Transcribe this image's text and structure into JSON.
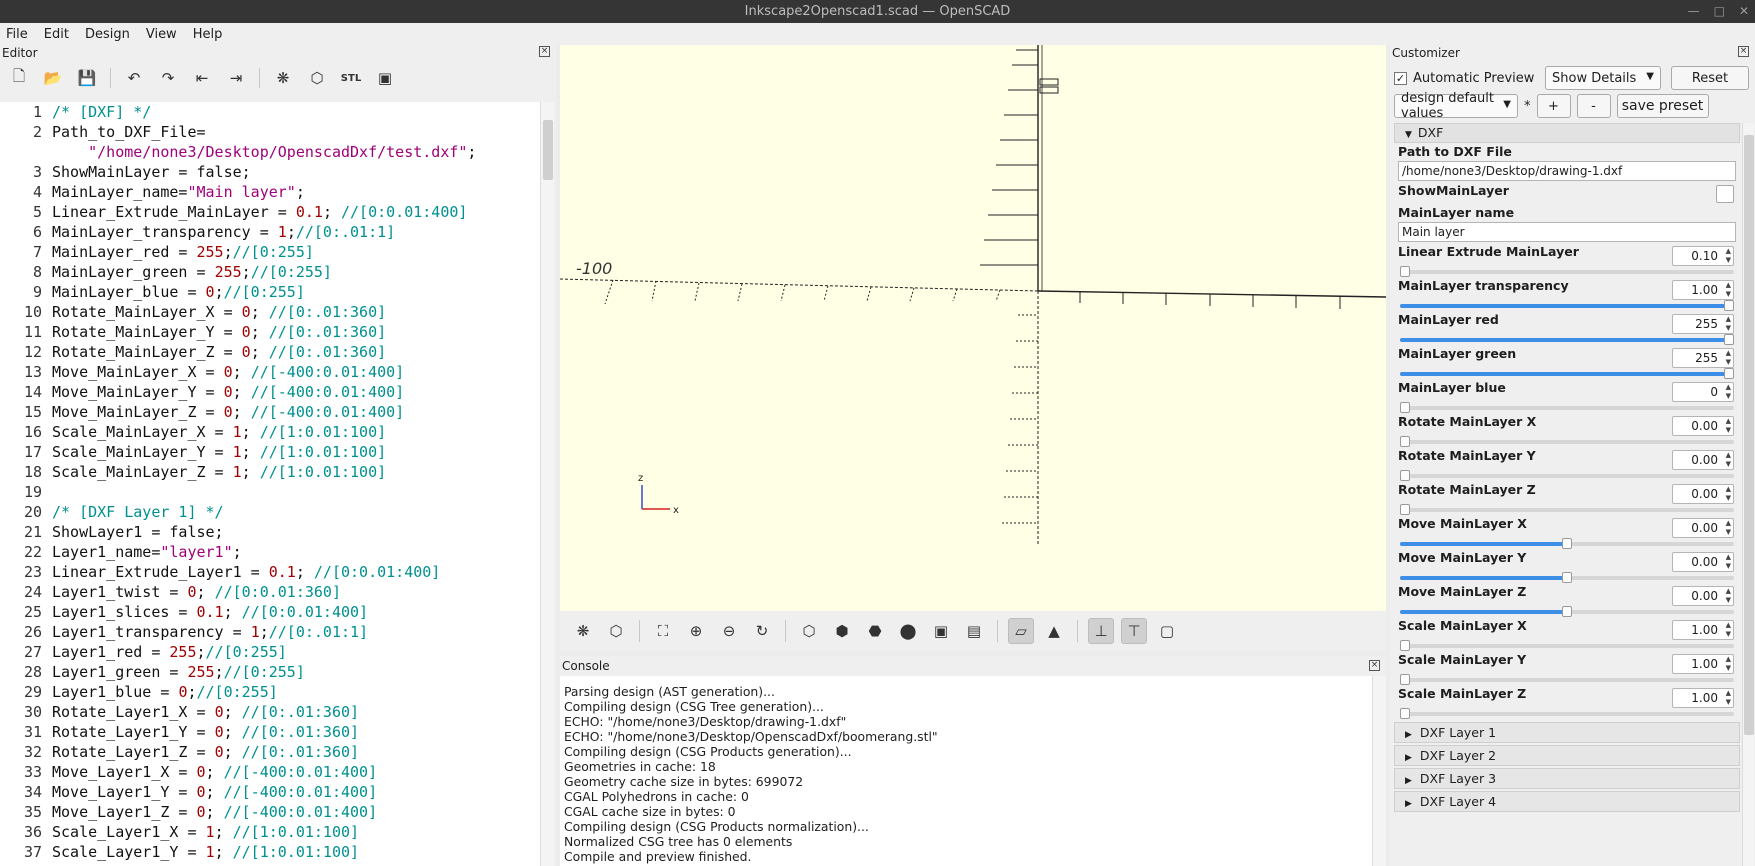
{
  "window": {
    "title": "Inkscape2Openscad1.scad — OpenSCAD"
  },
  "menu": [
    "File",
    "Edit",
    "Design",
    "View",
    "Help"
  ],
  "editor": {
    "title": "Editor",
    "lines": [
      {
        "n": "1",
        "t": [
          [
            "c-com",
            "/* [DXF] */"
          ]
        ]
      },
      {
        "n": "2",
        "t": [
          [
            "code",
            "Path_to_DXF_File="
          ]
        ]
      },
      {
        "n": "",
        "t": [
          [
            "code",
            "    "
          ],
          [
            "c-str",
            "\"/home/none3/Desktop/OpenscadDxf/test.dxf\""
          ],
          [
            "code",
            ";"
          ]
        ]
      },
      {
        "n": "3",
        "t": [
          [
            "code",
            "ShowMainLayer = false;"
          ]
        ]
      },
      {
        "n": "4",
        "t": [
          [
            "code",
            "MainLayer_name="
          ],
          [
            "c-str",
            "\"Main layer\""
          ],
          [
            "code",
            ";"
          ]
        ]
      },
      {
        "n": "5",
        "t": [
          [
            "code",
            "Linear_Extrude_MainLayer = "
          ],
          [
            "c-num",
            "0.1"
          ],
          [
            "code",
            "; "
          ],
          [
            "c-com",
            "//[0:0.01:400]"
          ]
        ]
      },
      {
        "n": "6",
        "t": [
          [
            "code",
            "MainLayer_transparency = "
          ],
          [
            "c-num",
            "1"
          ],
          [
            "code",
            ";"
          ],
          [
            "c-com",
            "//[0:.01:1]"
          ]
        ]
      },
      {
        "n": "7",
        "t": [
          [
            "code",
            "MainLayer_red = "
          ],
          [
            "c-num",
            "255"
          ],
          [
            "code",
            ";"
          ],
          [
            "c-com",
            "//[0:255]"
          ]
        ]
      },
      {
        "n": "8",
        "t": [
          [
            "code",
            "MainLayer_green = "
          ],
          [
            "c-num",
            "255"
          ],
          [
            "code",
            ";"
          ],
          [
            "c-com",
            "//[0:255]"
          ]
        ]
      },
      {
        "n": "9",
        "t": [
          [
            "code",
            "MainLayer_blue = "
          ],
          [
            "c-num",
            "0"
          ],
          [
            "code",
            ";"
          ],
          [
            "c-com",
            "//[0:255]"
          ]
        ]
      },
      {
        "n": "10",
        "t": [
          [
            "code",
            "Rotate_MainLayer_X = "
          ],
          [
            "c-num",
            "0"
          ],
          [
            "code",
            "; "
          ],
          [
            "c-com",
            "//[0:.01:360]"
          ]
        ]
      },
      {
        "n": "11",
        "t": [
          [
            "code",
            "Rotate_MainLayer_Y = "
          ],
          [
            "c-num",
            "0"
          ],
          [
            "code",
            "; "
          ],
          [
            "c-com",
            "//[0:.01:360]"
          ]
        ]
      },
      {
        "n": "12",
        "t": [
          [
            "code",
            "Rotate_MainLayer_Z = "
          ],
          [
            "c-num",
            "0"
          ],
          [
            "code",
            "; "
          ],
          [
            "c-com",
            "//[0:.01:360]"
          ]
        ]
      },
      {
        "n": "13",
        "t": [
          [
            "code",
            "Move_MainLayer_X = "
          ],
          [
            "c-num",
            "0"
          ],
          [
            "code",
            "; "
          ],
          [
            "c-com",
            "//[-400:0.01:400]"
          ]
        ]
      },
      {
        "n": "14",
        "t": [
          [
            "code",
            "Move_MainLayer_Y = "
          ],
          [
            "c-num",
            "0"
          ],
          [
            "code",
            "; "
          ],
          [
            "c-com",
            "//[-400:0.01:400]"
          ]
        ]
      },
      {
        "n": "15",
        "t": [
          [
            "code",
            "Move_MainLayer_Z = "
          ],
          [
            "c-num",
            "0"
          ],
          [
            "code",
            "; "
          ],
          [
            "c-com",
            "//[-400:0.01:400]"
          ]
        ]
      },
      {
        "n": "16",
        "t": [
          [
            "code",
            "Scale_MainLayer_X = "
          ],
          [
            "c-num",
            "1"
          ],
          [
            "code",
            "; "
          ],
          [
            "c-com",
            "//[1:0.01:100]"
          ]
        ]
      },
      {
        "n": "17",
        "t": [
          [
            "code",
            "Scale_MainLayer_Y = "
          ],
          [
            "c-num",
            "1"
          ],
          [
            "code",
            "; "
          ],
          [
            "c-com",
            "//[1:0.01:100]"
          ]
        ]
      },
      {
        "n": "18",
        "t": [
          [
            "code",
            "Scale_MainLayer_Z = "
          ],
          [
            "c-num",
            "1"
          ],
          [
            "code",
            "; "
          ],
          [
            "c-com",
            "//[1:0.01:100]"
          ]
        ]
      },
      {
        "n": "19",
        "t": [
          [
            "code",
            ""
          ]
        ]
      },
      {
        "n": "20",
        "t": [
          [
            "c-com",
            "/* [DXF Layer 1] */"
          ]
        ]
      },
      {
        "n": "21",
        "t": [
          [
            "code",
            "ShowLayer1 = false;"
          ]
        ]
      },
      {
        "n": "22",
        "t": [
          [
            "code",
            "Layer1_name="
          ],
          [
            "c-str",
            "\"layer1\""
          ],
          [
            "code",
            ";"
          ]
        ]
      },
      {
        "n": "23",
        "t": [
          [
            "code",
            "Linear_Extrude_Layer1 = "
          ],
          [
            "c-num",
            "0.1"
          ],
          [
            "code",
            "; "
          ],
          [
            "c-com",
            "//[0:0.01:400]"
          ]
        ]
      },
      {
        "n": "24",
        "t": [
          [
            "code",
            "Layer1_twist = "
          ],
          [
            "c-num",
            "0"
          ],
          [
            "code",
            "; "
          ],
          [
            "c-com",
            "//[0:0.01:360]"
          ]
        ]
      },
      {
        "n": "25",
        "t": [
          [
            "code",
            "Layer1_slices = "
          ],
          [
            "c-num",
            "0.1"
          ],
          [
            "code",
            "; "
          ],
          [
            "c-com",
            "//[0:0.01:400]"
          ]
        ]
      },
      {
        "n": "26",
        "t": [
          [
            "code",
            "Layer1_transparency = "
          ],
          [
            "c-num",
            "1"
          ],
          [
            "code",
            ";"
          ],
          [
            "c-com",
            "//[0:.01:1]"
          ]
        ]
      },
      {
        "n": "27",
        "t": [
          [
            "code",
            "Layer1_red = "
          ],
          [
            "c-num",
            "255"
          ],
          [
            "code",
            ";"
          ],
          [
            "c-com",
            "//[0:255]"
          ]
        ]
      },
      {
        "n": "28",
        "t": [
          [
            "code",
            "Layer1_green = "
          ],
          [
            "c-num",
            "255"
          ],
          [
            "code",
            ";"
          ],
          [
            "c-com",
            "//[0:255]"
          ]
        ]
      },
      {
        "n": "29",
        "t": [
          [
            "code",
            "Layer1_blue = "
          ],
          [
            "c-num",
            "0"
          ],
          [
            "code",
            ";"
          ],
          [
            "c-com",
            "//[0:255]"
          ]
        ]
      },
      {
        "n": "30",
        "t": [
          [
            "code",
            "Rotate_Layer1_X = "
          ],
          [
            "c-num",
            "0"
          ],
          [
            "code",
            "; "
          ],
          [
            "c-com",
            "//[0:.01:360]"
          ]
        ]
      },
      {
        "n": "31",
        "t": [
          [
            "code",
            "Rotate_Layer1_Y = "
          ],
          [
            "c-num",
            "0"
          ],
          [
            "code",
            "; "
          ],
          [
            "c-com",
            "//[0:.01:360]"
          ]
        ]
      },
      {
        "n": "32",
        "t": [
          [
            "code",
            "Rotate_Layer1_Z = "
          ],
          [
            "c-num",
            "0"
          ],
          [
            "code",
            "; "
          ],
          [
            "c-com",
            "//[0:.01:360]"
          ]
        ]
      },
      {
        "n": "33",
        "t": [
          [
            "code",
            "Move_Layer1_X = "
          ],
          [
            "c-num",
            "0"
          ],
          [
            "code",
            "; "
          ],
          [
            "c-com",
            "//[-400:0.01:400]"
          ]
        ]
      },
      {
        "n": "34",
        "t": [
          [
            "code",
            "Move_Layer1_Y = "
          ],
          [
            "c-num",
            "0"
          ],
          [
            "code",
            "; "
          ],
          [
            "c-com",
            "//[-400:0.01:400]"
          ]
        ]
      },
      {
        "n": "35",
        "t": [
          [
            "code",
            "Move_Layer1_Z = "
          ],
          [
            "c-num",
            "0"
          ],
          [
            "code",
            "; "
          ],
          [
            "c-com",
            "//[-400:0.01:400]"
          ]
        ]
      },
      {
        "n": "36",
        "t": [
          [
            "code",
            "Scale_Layer1_X = "
          ],
          [
            "c-num",
            "1"
          ],
          [
            "code",
            "; "
          ],
          [
            "c-com",
            "//[1:0.01:100]"
          ]
        ]
      },
      {
        "n": "37",
        "t": [
          [
            "code",
            "Scale_Layer1_Y = "
          ],
          [
            "c-num",
            "1"
          ],
          [
            "code",
            "; "
          ],
          [
            "c-com",
            "//[1:0.01:100]"
          ]
        ]
      }
    ]
  },
  "viewport": {
    "axis_label_z": "z",
    "axis_label_x": "x",
    "scale_text": "-100"
  },
  "console": {
    "title": "Console",
    "lines": [
      "Parsing design (AST generation)...",
      "Compiling design (CSG Tree generation)...",
      "ECHO: \"/home/none3/Desktop/drawing-1.dxf\"",
      "ECHO: \"/home/none3/Desktop/OpenscadDxf/boomerang.stl\"",
      "Compiling design (CSG Products generation)...",
      "Geometries in cache: 18",
      "Geometry cache size in bytes: 699072",
      "CGAL Polyhedrons in cache: 0",
      "CGAL cache size in bytes: 0",
      "Compiling design (CSG Products normalization)...",
      "Normalized CSG tree has 0 elements",
      "Compile and preview finished."
    ]
  },
  "customizer": {
    "title": "Customizer",
    "auto_preview_label": "Automatic Preview",
    "details_combo": "Show Details",
    "reset_label": "Reset",
    "preset_combo": "design default values",
    "preset_star": "*",
    "plus_label": "+",
    "minus_label": "-",
    "save_preset_label": "save preset",
    "group_name": "DXF",
    "path_label": "Path to DXF File",
    "path_value": "/home/none3/Desktop/drawing-1.dxf",
    "show_label": "ShowMainLayer",
    "name_label": "MainLayer name",
    "name_value": "Main layer",
    "numeric": [
      {
        "label": "Linear Extrude MainLayer",
        "value": "0.10",
        "frac": 0.0
      },
      {
        "label": "MainLayer transparency",
        "value": "1.00",
        "frac": 1.0
      },
      {
        "label": "MainLayer red",
        "value": "255",
        "frac": 1.0
      },
      {
        "label": "MainLayer green",
        "value": "255",
        "frac": 1.0
      },
      {
        "label": "MainLayer blue",
        "value": "0",
        "frac": 0.0
      },
      {
        "label": "Rotate MainLayer X",
        "value": "0.00",
        "frac": 0.0
      },
      {
        "label": "Rotate MainLayer Y",
        "value": "0.00",
        "frac": 0.0
      },
      {
        "label": "Rotate MainLayer Z",
        "value": "0.00",
        "frac": 0.0
      },
      {
        "label": "Move MainLayer X",
        "value": "0.00",
        "frac": 0.5
      },
      {
        "label": "Move MainLayer Y",
        "value": "0.00",
        "frac": 0.5
      },
      {
        "label": "Move MainLayer Z",
        "value": "0.00",
        "frac": 0.5
      },
      {
        "label": "Scale MainLayer X",
        "value": "1.00",
        "frac": 0.0
      },
      {
        "label": "Scale MainLayer Y",
        "value": "1.00",
        "frac": 0.0
      },
      {
        "label": "Scale MainLayer Z",
        "value": "1.00",
        "frac": 0.0
      }
    ],
    "collapsed_groups": [
      "DXF Layer 1",
      "DXF Layer 2",
      "DXF Layer 3",
      "DXF Layer 4"
    ]
  },
  "colors": {
    "viewport_bg": "#ffffe5",
    "slider_fill": "#3d8ee6",
    "comment": "#009090",
    "string": "#a0007a",
    "number": "#a00000"
  }
}
